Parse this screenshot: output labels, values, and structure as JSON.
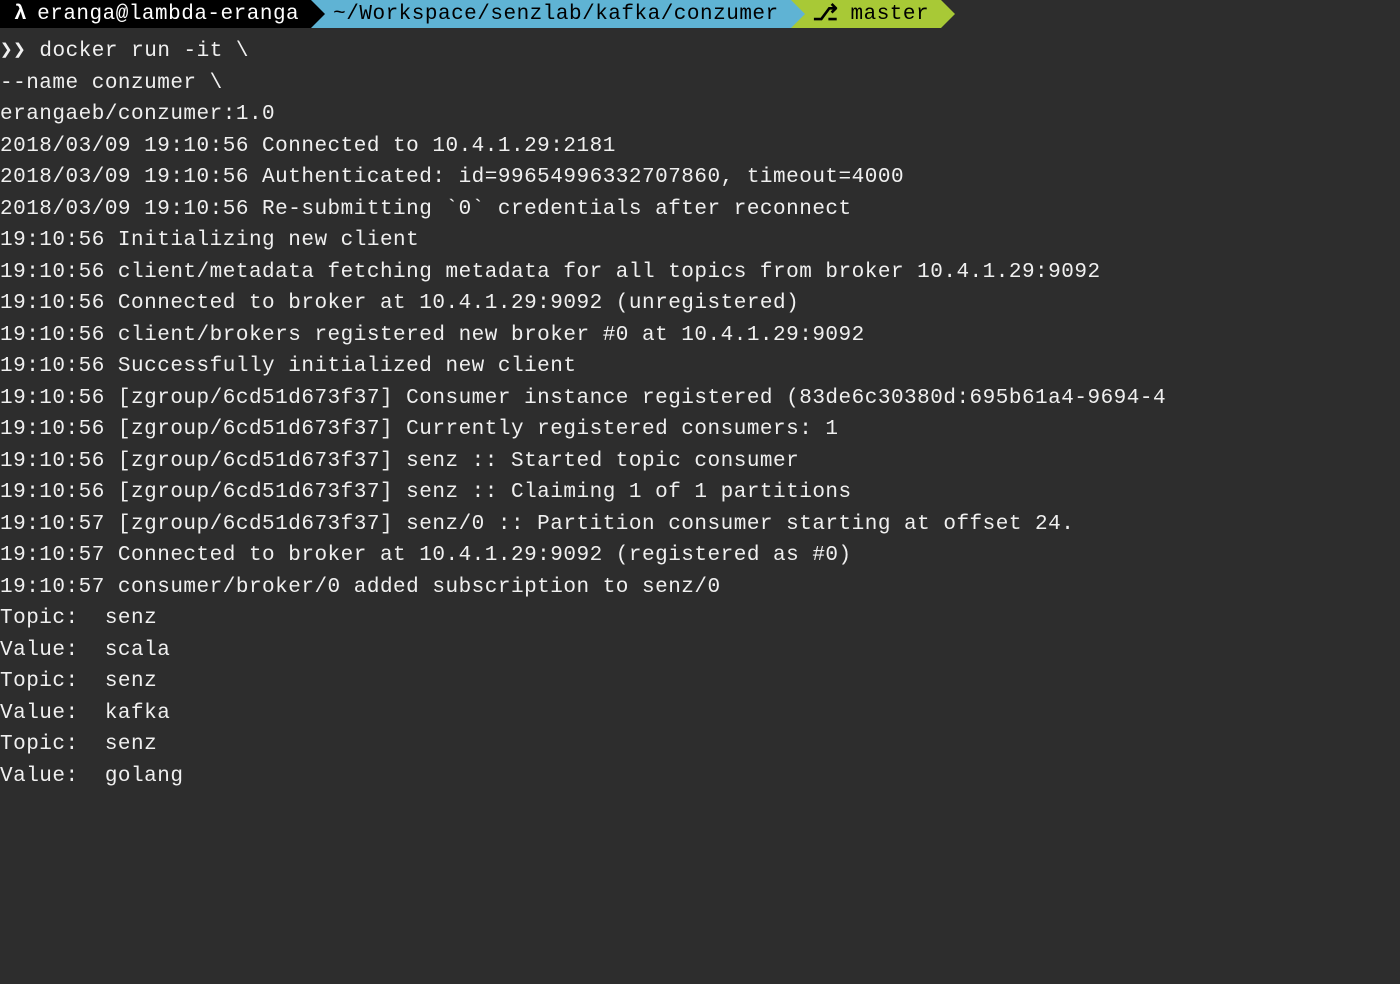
{
  "statusbar": {
    "lambda": "λ",
    "user": "eranga@lambda-eranga",
    "path": "~/Workspace/senzlab/kafka/conzumer",
    "branch_icon": "⎇",
    "branch": "master"
  },
  "prompt": "❯❯",
  "command_lines": [
    " docker run -it \\",
    "--name conzumer \\",
    "erangaeb/conzumer:1.0"
  ],
  "output_lines": [
    "2018/03/09 19:10:56 Connected to 10.4.1.29:2181",
    "2018/03/09 19:10:56 Authenticated: id=99654996332707860, timeout=4000",
    "2018/03/09 19:10:56 Re-submitting `0` credentials after reconnect",
    "19:10:56 Initializing new client",
    "19:10:56 client/metadata fetching metadata for all topics from broker 10.4.1.29:9092",
    "19:10:56 Connected to broker at 10.4.1.29:9092 (unregistered)",
    "19:10:56 client/brokers registered new broker #0 at 10.4.1.29:9092",
    "19:10:56 Successfully initialized new client",
    "19:10:56 [zgroup/6cd51d673f37] Consumer instance registered (83de6c30380d:695b61a4-9694-4",
    "19:10:56 [zgroup/6cd51d673f37] Currently registered consumers: 1",
    "19:10:56 [zgroup/6cd51d673f37] senz :: Started topic consumer",
    "19:10:56 [zgroup/6cd51d673f37] senz :: Claiming 1 of 1 partitions",
    "19:10:57 [zgroup/6cd51d673f37] senz/0 :: Partition consumer starting at offset 24.",
    "19:10:57 Connected to broker at 10.4.1.29:9092 (registered as #0)",
    "19:10:57 consumer/broker/0 added subscription to senz/0",
    "Topic:  senz",
    "Value:  scala",
    "",
    "Topic:  senz",
    "Value:  kafka",
    "",
    "Topic:  senz",
    "Value:  golang"
  ]
}
